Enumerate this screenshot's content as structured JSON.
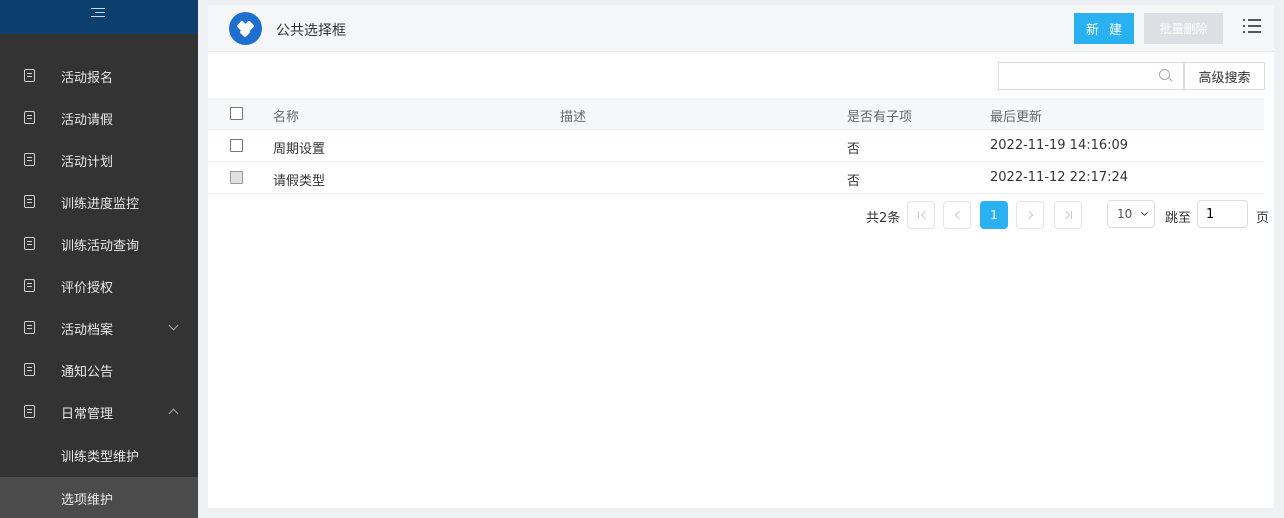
{
  "sidebar": {
    "items": [
      {
        "label": "活动报名"
      },
      {
        "label": "活动请假"
      },
      {
        "label": "活动计划"
      },
      {
        "label": "训练进度监控"
      },
      {
        "label": "训练活动查询"
      },
      {
        "label": "评价授权"
      },
      {
        "label": "活动档案"
      },
      {
        "label": "通知公告"
      },
      {
        "label": "日常管理"
      }
    ],
    "sub_items": [
      {
        "label": "训练类型维护"
      },
      {
        "label": "选项维护"
      }
    ]
  },
  "header": {
    "title": "公共选择框",
    "new_label": "新 建",
    "batch_delete_label": "批量删除"
  },
  "search": {
    "placeholder": "",
    "advanced_label": "高级搜索"
  },
  "table": {
    "columns": [
      "名称",
      "描述",
      "是否有子项",
      "最后更新"
    ],
    "rows": [
      {
        "name": "周期设置",
        "desc": "",
        "has_children": "否",
        "updated": "2022-11-19 14:16:09"
      },
      {
        "name": "请假类型",
        "desc": "",
        "has_children": "否",
        "updated": "2022-11-12 22:17:24"
      }
    ]
  },
  "pagination": {
    "total_label": "共2条",
    "current_page": "1",
    "page_size": "10",
    "jump_label": "跳至",
    "jump_value": "1",
    "page_unit": "页"
  },
  "colors": {
    "accent": "#2ab1f2",
    "sidebar_bg": "#333333",
    "sidebar_top": "#0c3e6e"
  }
}
